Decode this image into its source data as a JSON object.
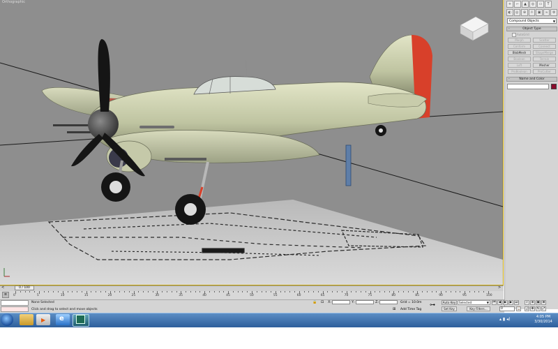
{
  "viewport": {
    "label": "Orthographic"
  },
  "command_panel": {
    "tabs": [
      "+",
      "⌐",
      "▲",
      "◎",
      "▭",
      "T"
    ],
    "create_icons": [
      "◐",
      "◎",
      "⊕",
      "☼",
      "▣",
      "≈",
      "⚙"
    ],
    "category_dropdown": "Compound Objects",
    "object_type_header": "Object Type",
    "autogrid_label": "AutoGrid",
    "buttons": [
      {
        "label": "Morph",
        "active": false
      },
      {
        "label": "Scatter",
        "active": false
      },
      {
        "label": "Conform",
        "active": false
      },
      {
        "label": "Connect",
        "active": false
      },
      {
        "label": "BlobMesh",
        "active": true
      },
      {
        "label": "ShapeMerge",
        "active": false
      },
      {
        "label": "Boolean",
        "active": false
      },
      {
        "label": "Terrain",
        "active": false
      },
      {
        "label": "Loft",
        "active": false
      },
      {
        "label": "Mesher",
        "active": true
      },
      {
        "label": "ProBoolean",
        "active": false
      },
      {
        "label": "ProCutter",
        "active": false
      }
    ],
    "name_color_header": "Name and Color",
    "swatch_color": "#8a0c2c"
  },
  "timeline": {
    "frame_indicator": "0 / 100",
    "ruler_labels": [
      "0",
      "5",
      "10",
      "15",
      "20",
      "25",
      "30",
      "35",
      "40",
      "45",
      "50",
      "55",
      "60",
      "65",
      "70",
      "75",
      "80",
      "85",
      "90",
      "95",
      "100"
    ]
  },
  "status": {
    "selection": "None Selected",
    "prompt": "Click and drag to select and move objects",
    "x_label": "X:",
    "y_label": "Y:",
    "z_label": "Z:",
    "grid": "Grid = 10.0m",
    "add_time_tag": "Add Time Tag",
    "auto_key": "Auto Key",
    "auto_key_mode": "Selected",
    "set_key": "Set Key",
    "key_filters": "Key Filters...",
    "current_frame": "0"
  },
  "taskbar": {
    "time": "4:05 PM",
    "date": "3/30/2014"
  }
}
